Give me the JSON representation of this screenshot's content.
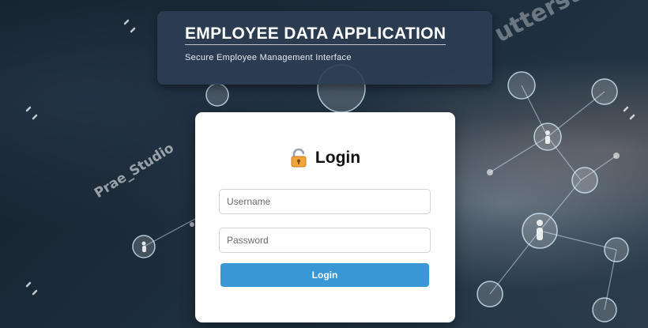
{
  "background": {
    "watermark_left": "Prae_Studio",
    "watermark_right": "utterst"
  },
  "header": {
    "title": "EMPLOYEE DATA APPLICATION",
    "subtitle": "Secure Employee Management Interface"
  },
  "login": {
    "title": "Login",
    "icon": "lock-icon",
    "username_placeholder": "Username",
    "password_placeholder": "Password",
    "button_label": "Login"
  },
  "colors": {
    "header_bg": "#2c3e54",
    "button_bg": "#3a97d6",
    "card_bg": "#ffffff"
  }
}
